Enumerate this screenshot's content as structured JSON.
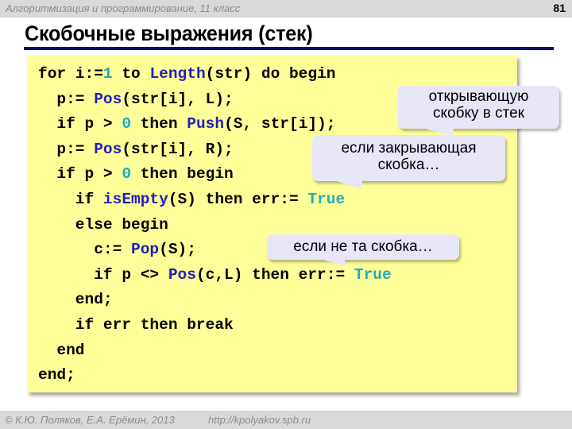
{
  "header": {
    "course": "Алгоритмизация и программирование, 11 класс",
    "page_number": "81"
  },
  "slide": {
    "title": "Скобочные выражения (стек)"
  },
  "code": {
    "lines": [
      [
        {
          "t": "for i:="
        },
        {
          "t": "1",
          "c": "num"
        },
        {
          "t": " to "
        },
        {
          "t": "Length",
          "c": "fn"
        },
        {
          "t": "(str) do begin"
        }
      ],
      [
        {
          "t": "  p:= "
        },
        {
          "t": "Pos",
          "c": "fn"
        },
        {
          "t": "(str[i], L);"
        }
      ],
      [
        {
          "t": "  if p > "
        },
        {
          "t": "0",
          "c": "num"
        },
        {
          "t": " then "
        },
        {
          "t": "Push",
          "c": "fn"
        },
        {
          "t": "(S, str[i]);"
        }
      ],
      [
        {
          "t": "  p:= "
        },
        {
          "t": "Pos",
          "c": "fn"
        },
        {
          "t": "(str[i], R);"
        }
      ],
      [
        {
          "t": "  if p > "
        },
        {
          "t": "0",
          "c": "num"
        },
        {
          "t": " then begin"
        }
      ],
      [
        {
          "t": "    if "
        },
        {
          "t": "isEmpty",
          "c": "fn"
        },
        {
          "t": "(S) then err:= "
        },
        {
          "t": "True",
          "c": "num"
        }
      ],
      [
        {
          "t": "    else begin"
        }
      ],
      [
        {
          "t": "      c:= "
        },
        {
          "t": "Pop",
          "c": "fn"
        },
        {
          "t": "(S);"
        }
      ],
      [
        {
          "t": "      if p <> "
        },
        {
          "t": "Pos",
          "c": "fn"
        },
        {
          "t": "(c,L) then err:= "
        },
        {
          "t": "True",
          "c": "num"
        }
      ],
      [
        {
          "t": "    end;"
        }
      ],
      [
        {
          "t": "    if err then break"
        }
      ],
      [
        {
          "t": "  end"
        }
      ],
      [
        {
          "t": "end;"
        }
      ]
    ],
    "colors": {
      "background": "#ffff99",
      "function": "#1f1fbf",
      "literal": "#23aabf",
      "text": "#000000"
    }
  },
  "callouts": [
    {
      "line1": "открывающую",
      "line2": "скобку в стек"
    },
    {
      "line1": "если закрывающая",
      "line2": "скобка…"
    },
    {
      "line1": "если не та скобка…"
    }
  ],
  "footer": {
    "copyright": "© К.Ю. Поляков, Е.А. Ерёмин, 2013",
    "url": "http://kpolyakov.spb.ru"
  }
}
